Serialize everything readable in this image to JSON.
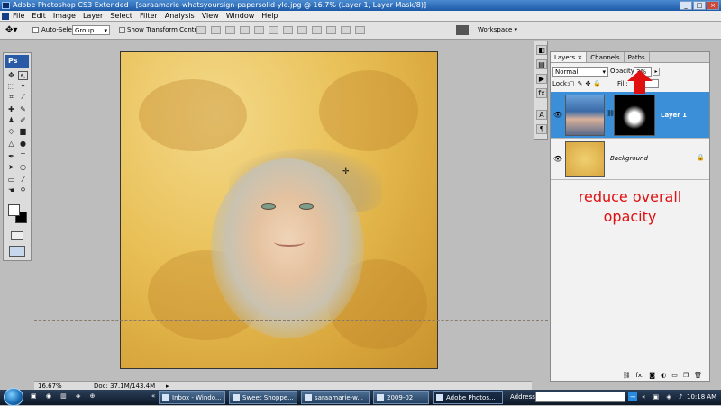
{
  "window": {
    "title": "Adobe Photoshop CS3 Extended - [saraamarie-whatsyoursign-papersolid-ylo.jpg @ 16.7% (Layer 1, Layer Mask/8)]",
    "minimize": "_",
    "maximize": "□",
    "close": "×"
  },
  "menu": [
    "File",
    "Edit",
    "Image",
    "Layer",
    "Select",
    "Filter",
    "Analysis",
    "View",
    "Window",
    "Help"
  ],
  "options": {
    "auto_select_label": "Auto-Select:",
    "auto_select_value": "Group",
    "show_transform_label": "Show Transform Controls",
    "workspace_label": "Workspace ▾"
  },
  "toolbox": {
    "logo": "Ps"
  },
  "layers_panel": {
    "tabs": [
      "Layers ×",
      "Channels",
      "Paths"
    ],
    "blend_mode": "Normal",
    "opacity_label": "Opacity:",
    "opacity_value": "3%",
    "lock_label": "Lock:",
    "fill_label": "Fill:",
    "layers": [
      {
        "name": "Layer 1",
        "selected": true
      },
      {
        "name": "Background",
        "selected": false
      }
    ]
  },
  "annotation": {
    "text": "reduce overall opacity",
    "color": "#e01010"
  },
  "status": {
    "zoom": "16.67%",
    "doc": "Doc: 37.1M/143.4M"
  },
  "taskbar": {
    "tasks": [
      "Inbox - Windo...",
      "Sweet Shoppe...",
      "saraamarie-w...",
      "2009-02",
      "Adobe Photos..."
    ],
    "address_label": "Address",
    "clock": "10:18 AM"
  },
  "colors": {
    "selected_layer": "#3b8fd9",
    "title_bar": "#1c5aa8",
    "paper": "#e8bf55"
  }
}
